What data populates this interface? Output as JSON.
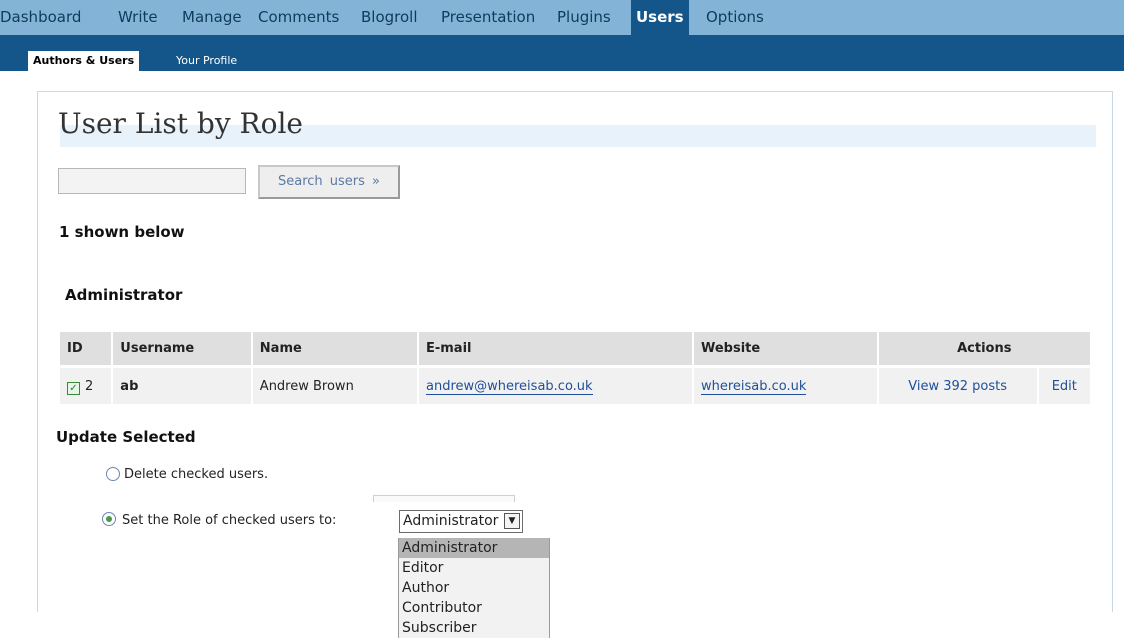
{
  "top_menu": {
    "items": [
      "Dashboard",
      "Write",
      "Manage",
      "Comments",
      "Blogroll",
      "Presentation",
      "Plugins",
      "Users",
      "Options"
    ],
    "active": "Users"
  },
  "sub_menu": {
    "items": [
      "Authors & Users",
      "Your Profile"
    ],
    "active": "Authors & Users"
  },
  "page": {
    "title": "User List by Role",
    "search": {
      "value": "",
      "button_label": "Search users »"
    },
    "shown_count": "1 shown below"
  },
  "role_section": {
    "heading": "Administrator",
    "columns": [
      "ID",
      "Username",
      "Name",
      "E-mail",
      "Website",
      "Actions"
    ],
    "rows": [
      {
        "checked": true,
        "id": "2",
        "username": "ab",
        "name": "Andrew Brown",
        "email": "andrew@whereisab.co.uk",
        "website": "whereisab.co.uk",
        "view_posts": "View 392 posts",
        "edit": "Edit"
      }
    ]
  },
  "update": {
    "heading": "Update Selected",
    "delete_option": "Delete checked users.",
    "set_role_option": "Set the Role of checked users to:",
    "selected_option": "set_role",
    "role_select": {
      "value": "Administrator",
      "options": [
        "Administrator",
        "Editor",
        "Author",
        "Contributor",
        "Subscriber"
      ],
      "highlighted": "Administrator"
    }
  },
  "colors": {
    "top_menu_bg": "#83b4d8",
    "sub_menu_bg": "#14568a",
    "link": "#1f4f9a",
    "title_bar": "#e8f2fb"
  },
  "icons": [
    "checkbox-checked-icon",
    "radio-icon",
    "chevron-down-icon"
  ]
}
